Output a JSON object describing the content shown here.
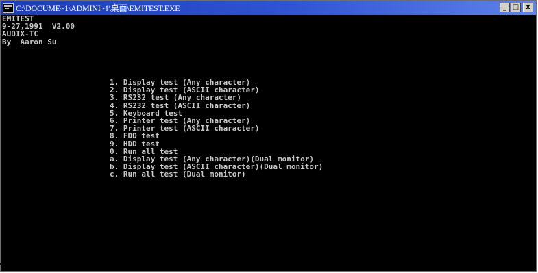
{
  "window": {
    "title": "C:\\DOCUME~1\\ADMINI~1\\桌面\\EMITEST.EXE",
    "controls": {
      "minimize": "_",
      "maximize": "□",
      "close": "x"
    }
  },
  "console": {
    "header_lines": [
      "EMITEST",
      "9-27,1991  V2.00",
      "AUDIX-TC",
      "By  Aaron Su"
    ],
    "menu_items": [
      "1. Display test (Any character)",
      "2. Display test (ASCII character)",
      "3. RS232 test (Any character)",
      "4. RS232 test (ASCII character)",
      "5. Keyboard test",
      "6. Printer test (Any character)",
      "7. Printer test (ASCII character)",
      "8. FDD test",
      "9. HDD test",
      "0. Run all test",
      "a. Display test (Any character)(Dual monitor)",
      "b. Display test (ASCII character)(Dual monitor)",
      "c. Run all test (Dual monitor)"
    ]
  },
  "colors": {
    "titlebar_start": "#1d3db5",
    "titlebar_end": "#5f82e8",
    "console_bg": "#000000",
    "console_fg": "#c8c8c8"
  },
  "icons": {
    "app": "console-window-icon",
    "minimize": "minimize-icon",
    "maximize": "maximize-icon",
    "close": "close-icon"
  }
}
